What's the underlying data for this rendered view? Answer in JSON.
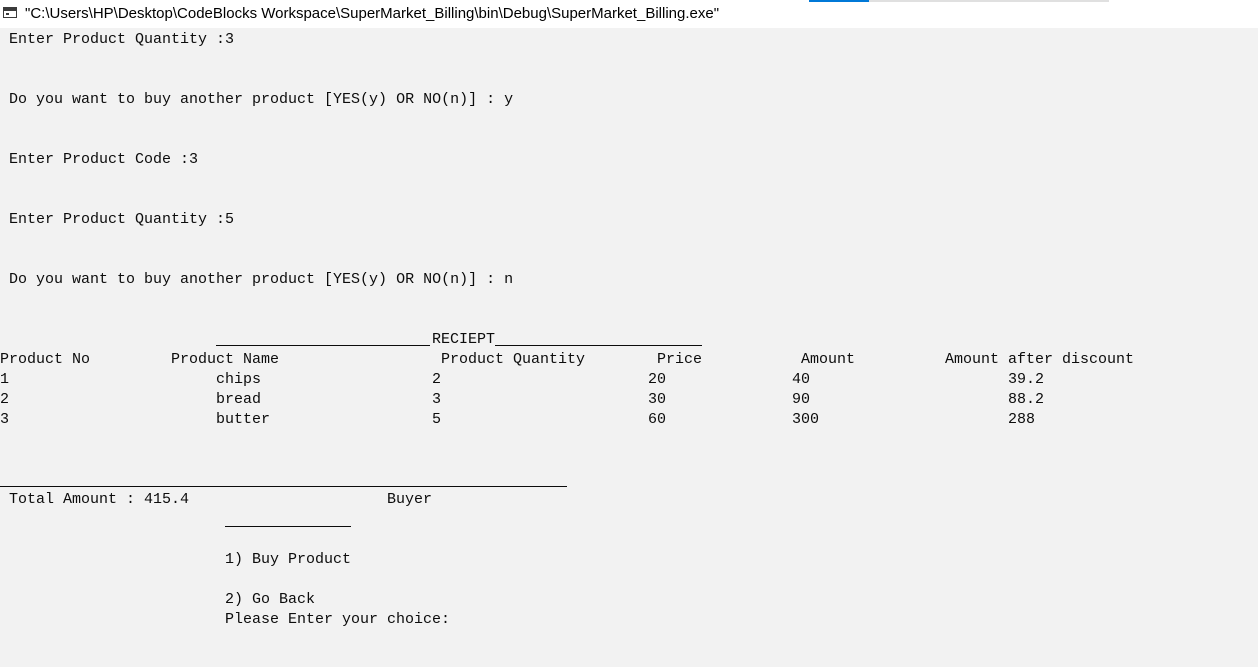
{
  "window": {
    "title": "\"C:\\Users\\HP\\Desktop\\CodeBlocks Workspace\\SuperMarket_Billing\\bin\\Debug\\SuperMarket_Billing.exe\"",
    "accent_color": "#0078d7"
  },
  "console": {
    "prompts": {
      "qty_1": "Enter Product Quantity :3",
      "another_1": "Do you want to buy another product [YES(y) OR NO(n)] : y",
      "code_3": "Enter Product Code :3",
      "qty_2": "Enter Product Quantity :5",
      "another_2": "Do you want to buy another product [YES(y) OR NO(n)] : n"
    },
    "receipt": {
      "title": "RECIEPT",
      "headers": {
        "product_no": "Product No",
        "product_name": "Product Name",
        "product_quantity": "Product Quantity",
        "price": "Price",
        "amount": "Amount",
        "amount_after_discount": "Amount after discount"
      },
      "rows": [
        {
          "no": "1",
          "name": "chips",
          "quantity": "2",
          "price": "20",
          "amount": "40",
          "discounted": "39.2"
        },
        {
          "no": "2",
          "name": "bread",
          "quantity": "3",
          "price": "30",
          "amount": "90",
          "discounted": "88.2"
        },
        {
          "no": "3",
          "name": "butter",
          "quantity": "5",
          "price": "60",
          "amount": "300",
          "discounted": "288"
        }
      ],
      "total": "Total Amount : 415.4"
    },
    "menu": {
      "heading": "Buyer",
      "option_1": "1) Buy Product",
      "option_2": "2) Go Back",
      "prompt": "Please Enter your choice:"
    }
  }
}
